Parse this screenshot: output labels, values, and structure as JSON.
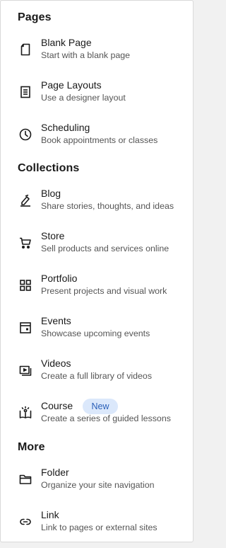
{
  "sections": {
    "pages": {
      "title": "Pages"
    },
    "collections": {
      "title": "Collections"
    },
    "more": {
      "title": "More"
    }
  },
  "items": {
    "blank_page": {
      "label": "Blank Page",
      "desc": "Start with a blank page",
      "icon": "blank-page-icon"
    },
    "page_layouts": {
      "label": "Page Layouts",
      "desc": "Use a designer layout",
      "icon": "layout-icon"
    },
    "scheduling": {
      "label": "Scheduling",
      "desc": "Book appointments or classes",
      "icon": "clock-icon"
    },
    "blog": {
      "label": "Blog",
      "desc": "Share stories, thoughts, and ideas",
      "icon": "pen-icon"
    },
    "store": {
      "label": "Store",
      "desc": "Sell products and services online",
      "icon": "cart-icon"
    },
    "portfolio": {
      "label": "Portfolio",
      "desc": "Present projects and visual work",
      "icon": "grid-icon"
    },
    "events": {
      "label": "Events",
      "desc": "Showcase upcoming events",
      "icon": "calendar-icon"
    },
    "videos": {
      "label": "Videos",
      "desc": "Create a full library of videos",
      "icon": "video-icon"
    },
    "course": {
      "label": "Course",
      "desc": "Create a series of guided lessons",
      "badge": "New",
      "icon": "book-icon"
    },
    "folder": {
      "label": "Folder",
      "desc": "Organize your site navigation",
      "icon": "folder-icon"
    },
    "link": {
      "label": "Link",
      "desc": "Link to pages or external sites",
      "icon": "link-icon"
    }
  },
  "colors": {
    "badge_bg": "#dbe8fb",
    "badge_text": "#2a5fb8",
    "text": "#1a1a1a",
    "muted": "#555555"
  }
}
